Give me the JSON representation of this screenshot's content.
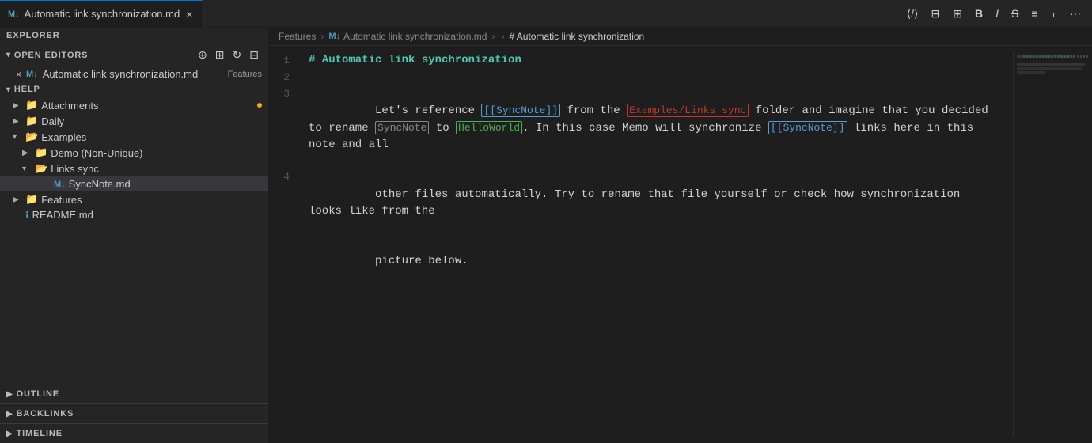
{
  "tab_bar": {
    "tab_label": "Automatic link synchronization.md",
    "tab_icon": "M↓",
    "close_label": "×"
  },
  "toolbar": {
    "buttons": [
      {
        "name": "source-icon",
        "label": "⟨/⟩"
      },
      {
        "name": "columns-icon",
        "label": "⊟"
      },
      {
        "name": "layout-icon",
        "label": "⊞"
      },
      {
        "name": "bold-button",
        "label": "B"
      },
      {
        "name": "italic-button",
        "label": "I"
      },
      {
        "name": "strike-button",
        "label": "S"
      },
      {
        "name": "list-icon",
        "label": "≡"
      },
      {
        "name": "split-icon",
        "label": "⫝"
      },
      {
        "name": "more-icon",
        "label": "…"
      }
    ]
  },
  "sidebar": {
    "explorer_label": "EXPLORER",
    "open_editors_label": "OPEN EDITORS",
    "open_editor_file": "Automatic link synchronization.md",
    "open_editor_badge": "Features",
    "help_label": "HELP",
    "tree_items": [
      {
        "id": "attachments",
        "label": "Attachments",
        "type": "folder",
        "indent": 1,
        "open": false,
        "color": "teal",
        "has_dot": true
      },
      {
        "id": "daily",
        "label": "Daily",
        "type": "folder",
        "indent": 1,
        "open": false,
        "color": "teal"
      },
      {
        "id": "examples",
        "label": "Examples",
        "type": "folder",
        "indent": 1,
        "open": true,
        "color": "teal"
      },
      {
        "id": "demo",
        "label": "Demo (Non-Unique)",
        "type": "folder",
        "indent": 2,
        "open": false,
        "color": "teal"
      },
      {
        "id": "links-sync",
        "label": "Links sync",
        "type": "folder",
        "indent": 2,
        "open": true,
        "color": "teal"
      },
      {
        "id": "syncnote",
        "label": "SyncNote.md",
        "type": "file",
        "indent": 4,
        "open": false
      },
      {
        "id": "features",
        "label": "Features",
        "type": "folder",
        "indent": 1,
        "open": false,
        "color": "teal"
      },
      {
        "id": "readme",
        "label": "README.md",
        "type": "file",
        "indent": 1,
        "open": false,
        "icon_color": "blue"
      }
    ],
    "outline_label": "OUTLINE",
    "backlinks_label": "BACKLINKS",
    "timeline_label": "TIMELINE"
  },
  "breadcrumb": {
    "features": "Features",
    "sep1": ">",
    "md_icon": "M↓",
    "file": "Automatic link synchronization.md",
    "sep2": ">",
    "chevron": "›",
    "heading": "# Automatic link synchronization"
  },
  "editor": {
    "lines": [
      {
        "number": "1",
        "content": "# Automatic link synchronization",
        "type": "heading"
      },
      {
        "number": "2",
        "content": "",
        "type": "empty"
      },
      {
        "number": "3",
        "type": "mixed",
        "parts": [
          {
            "text": "Let's reference ",
            "style": "normal"
          },
          {
            "text": "[[SyncNote]]",
            "style": "link-blue"
          },
          {
            "text": " from the ",
            "style": "normal"
          },
          {
            "text": "Examples/Links sync",
            "style": "link-red"
          },
          {
            "text": " folder and imagine that you decided to rename ",
            "style": "normal"
          },
          {
            "text": "SyncNote",
            "style": "link-gray"
          },
          {
            "text": " to ",
            "style": "normal"
          },
          {
            "text": "HelloWorld",
            "style": "link-green"
          },
          {
            "text": ". In this case Memo will synchronize ",
            "style": "normal"
          },
          {
            "text": "[[SyncNote]]",
            "style": "link-blue"
          },
          {
            "text": " links here in this note and all",
            "style": "normal"
          },
          {
            "text": "other files automatically. Try to rename that file yourself or check how synchronization looks like from the",
            "style": "normal"
          },
          {
            "text": "picture below.",
            "style": "normal"
          }
        ]
      },
      {
        "number": "4",
        "content": "",
        "type": "empty"
      }
    ]
  }
}
